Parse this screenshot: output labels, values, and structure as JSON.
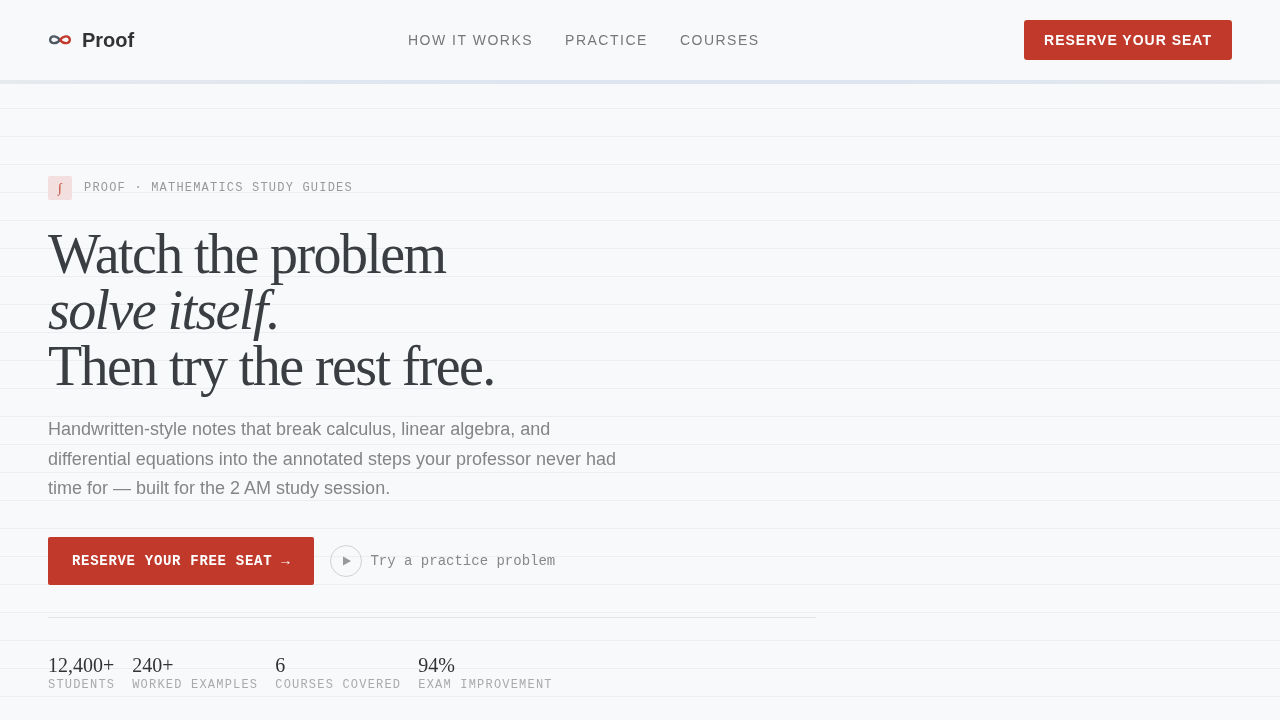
{
  "header": {
    "brand": "Proof",
    "nav": [
      {
        "label": "HOW IT WORKS"
      },
      {
        "label": "PRACTICE"
      },
      {
        "label": "COURSES"
      }
    ],
    "cta": "RESERVE YOUR SEAT"
  },
  "hero": {
    "eyebrow_mark": "∫",
    "eyebrow": "PROOF · MATHEMATICS STUDY GUIDES",
    "headline_lines": [
      "Watch the problem",
      "*solve itself.*",
      "Then try the rest free."
    ],
    "description": "Handwritten-style notes that break calculus, linear algebra, and differential equations into the annotated steps your professor never had time for — built for the 2 AM study session.",
    "primary_button": "RESERVE YOUR FREE SEAT →",
    "secondary_link": "Try a practice problem"
  },
  "stats": [
    {
      "value": "12,400+",
      "label": "STUDENTS"
    },
    {
      "value": "240+",
      "label": "WORKED EXAMPLES"
    },
    {
      "value": "6",
      "label": "COURSES COVERED"
    },
    {
      "value": "94%",
      "label": "EXAM IMPROVEMENT"
    }
  ]
}
